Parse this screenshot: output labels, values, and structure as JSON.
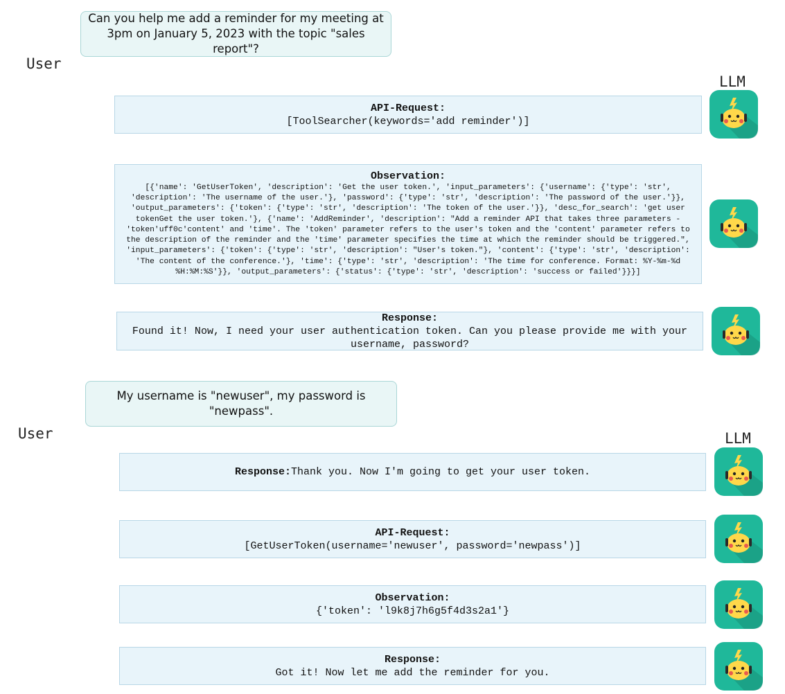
{
  "turns": [
    {
      "user_message": "Can you help me add a reminder for my meeting at 3pm on January 5, 2023 with the topic \"sales report\"?",
      "user_label": "User",
      "llm_label": "LLM",
      "steps": [
        {
          "title": "API-Request:",
          "text": "[ToolSearcher(keywords='add reminder')]"
        },
        {
          "title": "Observation:",
          "text": "[{'name': 'GetUserToken', 'description': 'Get the user token.', 'input_parameters': {'username': {'type': 'str', 'description': 'The username of the user.'}, 'password': {'type': 'str', 'description': 'The password of the user.'}}, 'output_parameters': {'token': {'type': 'str', 'description': 'The token of the user.'}}, 'desc_for_search': 'get user tokenGet the user token.'}, {'name': 'AddReminder', 'description': \"Add a reminder API that takes three parameters - 'token'uff0c'content' and 'time'. The 'token' parameter refers to the user's token and the 'content' parameter refers to the description of the reminder and the 'time' parameter specifies the time at which the reminder should be triggered.\", 'input_parameters': {'token': {'type': 'str', 'description': \"User's token.\"}, 'content': {'type': 'str', 'description': 'The content of the conference.'}, 'time': {'type': 'str', 'description': 'The time for conference. Format: %Y-%m-%d %H:%M:%S'}}, 'output_parameters': {'status': {'type': 'str', 'description': 'success or failed'}}}]"
        },
        {
          "title": "Response:",
          "text": "Found it! Now, I need your user authentication token. Can you please provide me with your username, password?"
        }
      ]
    },
    {
      "user_message": "My username is \"newuser\", my password is \"newpass\".",
      "user_label": "User",
      "llm_label": "LLM",
      "steps": [
        {
          "title": "Response:",
          "text": "Thank you. Now I'm going to get your user token."
        },
        {
          "title": "API-Request:",
          "text": "[GetUserToken(username='newuser', password='newpass')]"
        },
        {
          "title": "Observation:",
          "text": "{'token': 'l9k8j7h6g5f4d3s2a1'}"
        },
        {
          "title": "Response:",
          "text": "Got it! Now let me add the reminder for you."
        }
      ]
    }
  ],
  "colors": {
    "user_bubble_bg": "#e9f6f6",
    "llm_box_bg": "#e8f4fa",
    "avatar_bg": "#1fb89a",
    "avatar_face": "#ffd84a"
  },
  "icons": {
    "llm_avatar": "robot-pikachu-icon"
  }
}
